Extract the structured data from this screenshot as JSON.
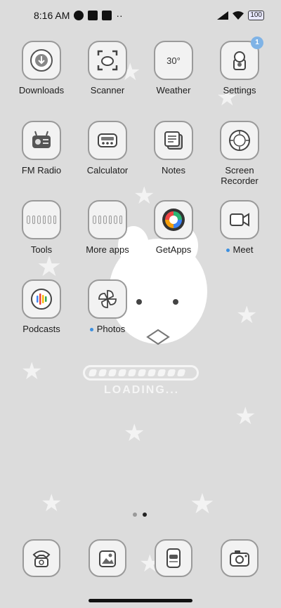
{
  "status": {
    "time": "8:16 AM",
    "more": "··",
    "battery": "100"
  },
  "apps": [
    {
      "label": "Downloads"
    },
    {
      "label": "Scanner"
    },
    {
      "label": "Weather",
      "temp": "30°"
    },
    {
      "label": "Settings",
      "badge": "1"
    },
    {
      "label": "FM Radio"
    },
    {
      "label": "Calculator"
    },
    {
      "label": "Notes"
    },
    {
      "label": "Screen Recorder"
    },
    {
      "label": "Tools"
    },
    {
      "label": "More apps"
    },
    {
      "label": "GetApps"
    },
    {
      "label": "Meet"
    },
    {
      "label": "Podcasts"
    },
    {
      "label": "Photos"
    }
  ],
  "wallpaper": {
    "loading_text": "LOADING..."
  },
  "pager": {
    "pages": 2,
    "active": 2
  }
}
